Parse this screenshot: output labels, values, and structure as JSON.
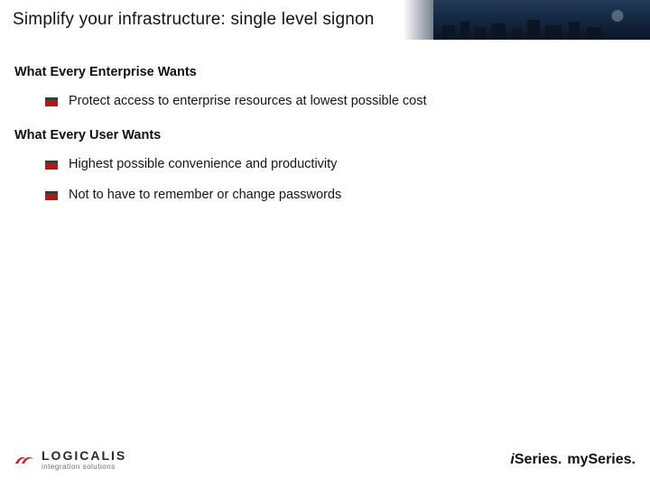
{
  "title": "Simplify your infrastructure: single level signon",
  "sections": [
    {
      "heading": "What Every Enterprise Wants",
      "bullets": [
        "Protect access to enterprise resources at lowest possible cost"
      ]
    },
    {
      "heading": "What Every User Wants",
      "bullets": [
        "Highest possible convenience and productivity",
        "Not to have to remember or change passwords"
      ]
    }
  ],
  "footer": {
    "left": {
      "name": "LOGICALIS",
      "tagline": "integration solutions"
    },
    "right": {
      "part1": "i",
      "part2": "Series",
      "dot1": ".",
      "part3": "my",
      "part4": "Series",
      "dot2": "."
    }
  }
}
